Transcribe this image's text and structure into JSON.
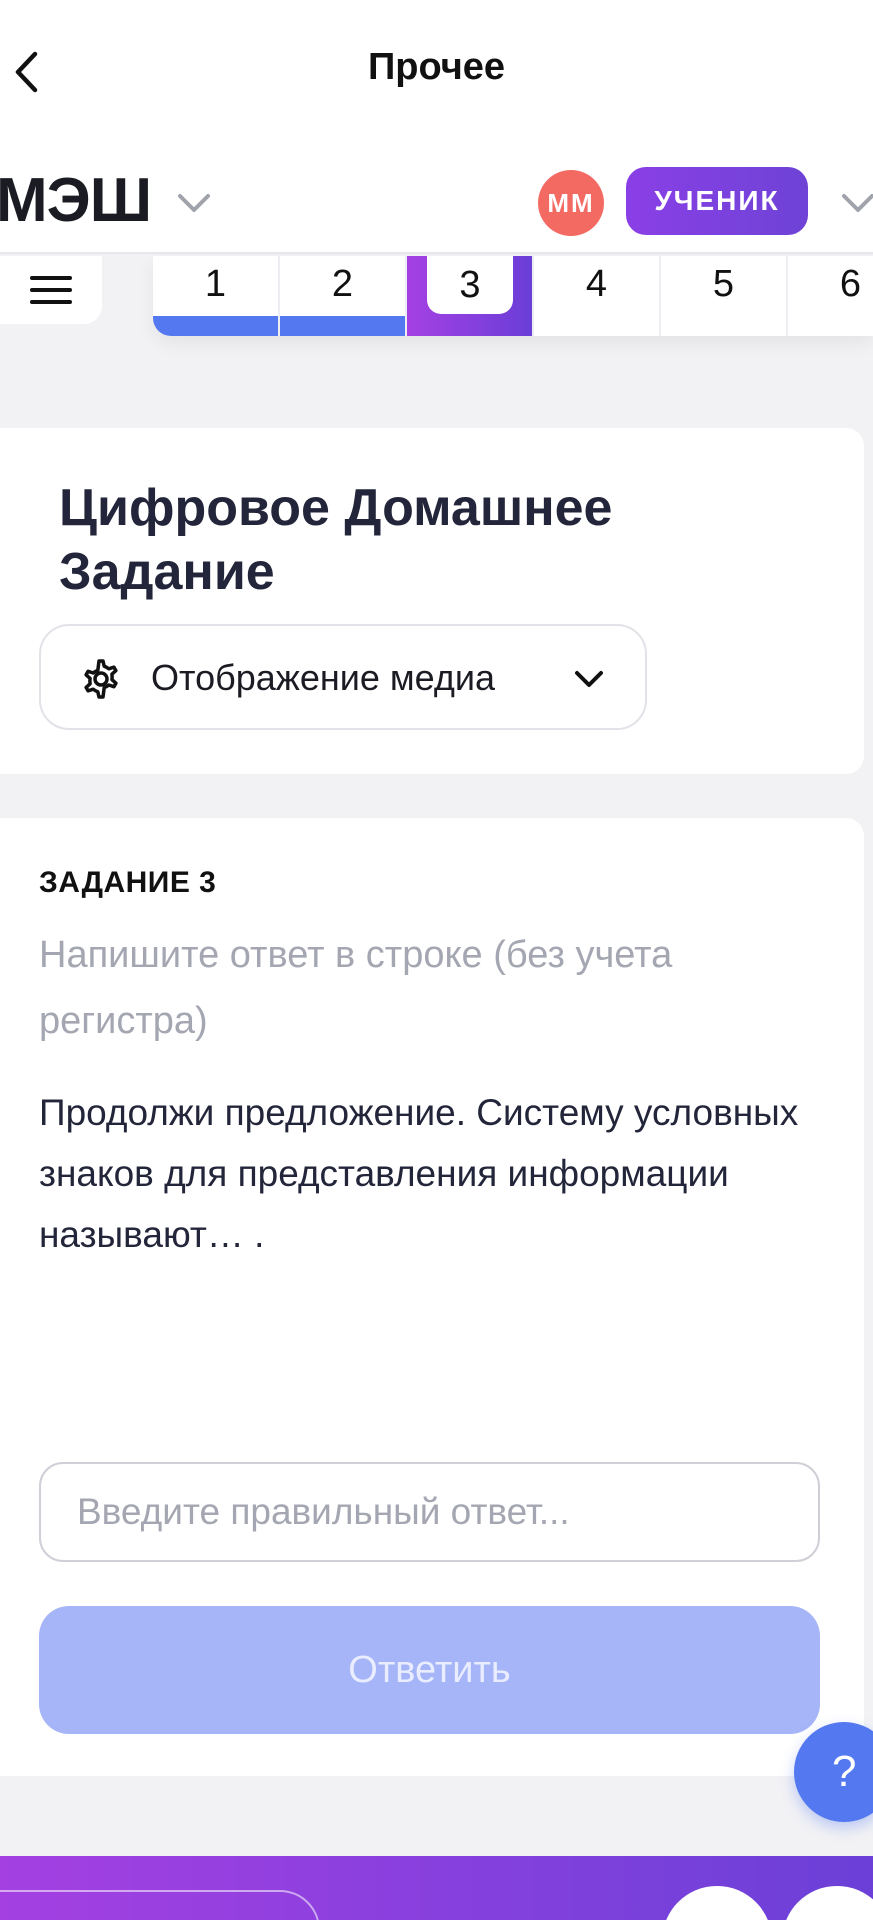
{
  "topbar": {
    "title": "Прочее",
    "back_icon": "chevron-left-icon"
  },
  "header": {
    "logo": "МЭШ",
    "avatar_initials": "ММ",
    "role": "УЧЕНИК",
    "chevron_icon": "chevron-down-icon"
  },
  "tasks": {
    "menu_icon": "menu-icon",
    "tabs": [
      {
        "label": "1",
        "status": "done"
      },
      {
        "label": "2",
        "status": "done"
      },
      {
        "label": "3",
        "status": "active"
      },
      {
        "label": "4",
        "status": "pending"
      },
      {
        "label": "5",
        "status": "pending"
      },
      {
        "label": "6",
        "status": "pending"
      }
    ]
  },
  "homework": {
    "title": "Цифровое Домашнее Задание",
    "media_label": "Отображение медиа",
    "media_icon": "gear-icon"
  },
  "task": {
    "label": "ЗАДАНИЕ 3",
    "hint": "Напишите ответ в строке (без учета регистра)",
    "text": "Продолжи предложение. Систему условных знаков для представления информации называют… .",
    "input_placeholder": "Введите правильный ответ...",
    "input_value": "",
    "submit_label": "Ответить"
  },
  "help": {
    "label": "?"
  },
  "colors": {
    "accent_purple": "#8A3FE6",
    "accent_blue": "#5478F0",
    "avatar": "#F36A63",
    "submit_disabled": "#A5B5F7"
  }
}
